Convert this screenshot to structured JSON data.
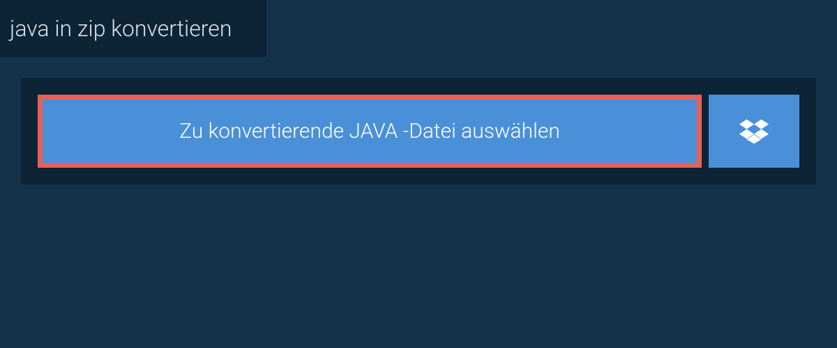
{
  "header": {
    "title": "java in zip konvertieren"
  },
  "upload": {
    "select_file_label": "Zu konvertierende JAVA -Datei auswählen"
  },
  "colors": {
    "background": "#14334b",
    "panel": "#0d2436",
    "button": "#4a90d9",
    "highlight_border": "#e7605a"
  }
}
